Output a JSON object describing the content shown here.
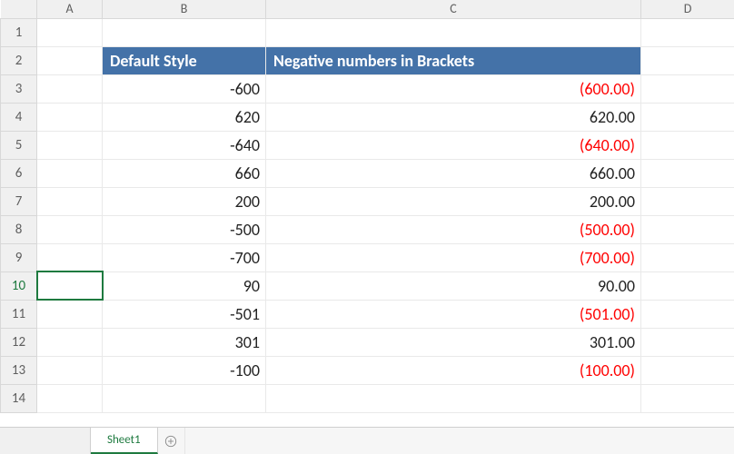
{
  "columns": [
    "A",
    "B",
    "C",
    "D"
  ],
  "row_numbers": [
    1,
    2,
    3,
    4,
    5,
    6,
    7,
    8,
    9,
    10,
    11,
    12,
    13,
    14
  ],
  "active_row": 10,
  "header": {
    "col_b": "Default Style",
    "col_c": "Negative numbers in Brackets"
  },
  "rows": [
    {
      "default": "-600",
      "bracket": "(600.00)",
      "neg": true
    },
    {
      "default": "620",
      "bracket": "620.00",
      "neg": false
    },
    {
      "default": "-640",
      "bracket": "(640.00)",
      "neg": true
    },
    {
      "default": "660",
      "bracket": "660.00",
      "neg": false
    },
    {
      "default": "200",
      "bracket": "200.00",
      "neg": false
    },
    {
      "default": "-500",
      "bracket": "(500.00)",
      "neg": true
    },
    {
      "default": "-700",
      "bracket": "(700.00)",
      "neg": true
    },
    {
      "default": "90",
      "bracket": "90.00",
      "neg": false
    },
    {
      "default": "-501",
      "bracket": "(501.00)",
      "neg": true
    },
    {
      "default": "301",
      "bracket": "301.00",
      "neg": false
    },
    {
      "default": "-100",
      "bracket": "(100.00)",
      "neg": true
    }
  ],
  "tabs": {
    "sheet1": "Sheet1"
  }
}
